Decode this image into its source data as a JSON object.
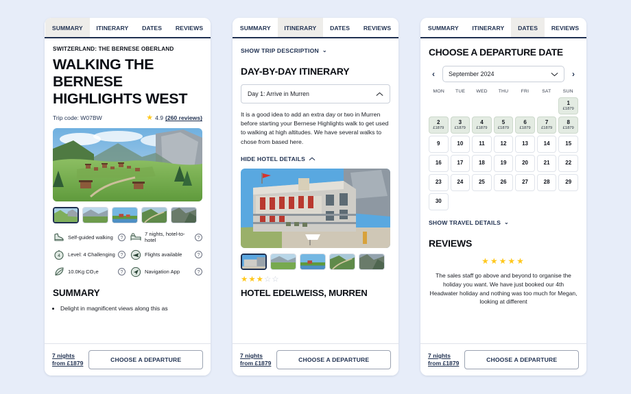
{
  "theme": {
    "background": "#e7edf9",
    "panel": "#ffffff",
    "ink": "#1f3050",
    "star": "#ffc81e",
    "available_day": "#e3ebe2",
    "active_tab": "#eeedea"
  },
  "tabs": [
    "SUMMARY",
    "ITINERARY",
    "DATES",
    "REVIEWS"
  ],
  "footer": {
    "nights_line1": "7 nights",
    "nights_line2": "from £1879",
    "cta": "CHOOSE A DEPARTURE"
  },
  "panel_summary": {
    "active_tab": "SUMMARY",
    "eyebrow": "SWITZERLAND: THE BERNESE OBERLAND",
    "title": "WALKING THE BERNESE HIGHLIGHTS WEST",
    "trip_code": "Trip code: W07BW",
    "rating_value": "4.9",
    "reviews_link": "(260 reviews)",
    "hero_alt": "alpine-village-hero-image",
    "thumbnails": [
      "alpine-village-thumb",
      "mountain-lake-thumb",
      "village-river-thumb",
      "mountain-trail-thumb",
      "valley-cliff-thumb"
    ],
    "features": [
      {
        "icon": "hiking-boot-icon",
        "label": "Self-guided walking"
      },
      {
        "icon": "hotel-bed-icon",
        "label": "7 nights, hotel-to-hotel"
      },
      {
        "icon": "difficulty-gauge-icon",
        "label": "Level: 4 Challenging"
      },
      {
        "icon": "airplane-icon",
        "label": "Flights available"
      },
      {
        "icon": "leaf-carbon-icon",
        "label": "10.0Kg CO₂e"
      },
      {
        "icon": "navigation-app-icon",
        "label": "Navigation App"
      }
    ],
    "help_icon": "question-mark-icon",
    "section_heading": "SUMMARY",
    "bullets": [
      "Delight in magnificent views along this as"
    ]
  },
  "panel_itinerary": {
    "active_tab": "ITINERARY",
    "show_trip_description": "SHOW TRIP DESCRIPTION",
    "heading": "DAY-BY-DAY ITINERARY",
    "accordion_label": "Day 1: Arrive in Murren",
    "accordion_state_icon": "chevron-up-icon",
    "paragraph": "It is a good idea to add an extra day or two in Murren before starting your Bernese Highlights walk to get used to walking at high altitudes. We have several walks to chose from based here.",
    "hide_hotel_details": "HIDE HOTEL DETAILS",
    "hotel_image_alt": "hotel-edelweiss-exterior",
    "hotel_thumbnails": [
      "hotel-exterior-thumb",
      "mountain-meadow-thumb",
      "village-river-thumb",
      "mountain-trail-thumb",
      "valley-cliff-thumb"
    ],
    "hotel_stars_filled": 3,
    "hotel_stars_total": 5,
    "hotel_name": "HOTEL EDELWEISS, MURREN"
  },
  "panel_dates": {
    "active_tab": "DATES",
    "heading": "CHOOSE A DEPARTURE DATE",
    "prev_icon": "chevron-left-icon",
    "next_icon": "chevron-right-icon",
    "month_value": "September 2024",
    "month_caret_icon": "chevron-down-icon",
    "day_names": [
      "MON",
      "TUE",
      "WED",
      "THU",
      "FRI",
      "SAT",
      "SUN"
    ],
    "leading_blanks": 6,
    "days": [
      {
        "n": "1",
        "price": "£1879",
        "available": true
      },
      {
        "n": "2",
        "price": "£1879",
        "available": true
      },
      {
        "n": "3",
        "price": "£1879",
        "available": true
      },
      {
        "n": "4",
        "price": "£1879",
        "available": true
      },
      {
        "n": "5",
        "price": "£1879",
        "available": true
      },
      {
        "n": "6",
        "price": "£1879",
        "available": true
      },
      {
        "n": "7",
        "price": "£1879",
        "available": true
      },
      {
        "n": "8",
        "price": "£1879",
        "available": true
      },
      {
        "n": "9",
        "price": "",
        "available": false
      },
      {
        "n": "10",
        "price": "",
        "available": false
      },
      {
        "n": "11",
        "price": "",
        "available": false
      },
      {
        "n": "12",
        "price": "",
        "available": false
      },
      {
        "n": "13",
        "price": "",
        "available": false
      },
      {
        "n": "14",
        "price": "",
        "available": false
      },
      {
        "n": "15",
        "price": "",
        "available": false
      },
      {
        "n": "16",
        "price": "",
        "available": false
      },
      {
        "n": "17",
        "price": "",
        "available": false
      },
      {
        "n": "18",
        "price": "",
        "available": false
      },
      {
        "n": "19",
        "price": "",
        "available": false
      },
      {
        "n": "20",
        "price": "",
        "available": false
      },
      {
        "n": "21",
        "price": "",
        "available": false
      },
      {
        "n": "22",
        "price": "",
        "available": false
      },
      {
        "n": "23",
        "price": "",
        "available": false
      },
      {
        "n": "24",
        "price": "",
        "available": false
      },
      {
        "n": "25",
        "price": "",
        "available": false
      },
      {
        "n": "26",
        "price": "",
        "available": false
      },
      {
        "n": "27",
        "price": "",
        "available": false
      },
      {
        "n": "28",
        "price": "",
        "available": false
      },
      {
        "n": "29",
        "price": "",
        "available": false
      },
      {
        "n": "30",
        "price": "",
        "available": false
      }
    ],
    "show_travel_details": "SHOW TRAVEL DETAILS",
    "reviews_heading": "REVIEWS",
    "review_stars": 5,
    "review_text": "The sales staff go above and beyond to organise the holiday you want. We have just booked our 4th Headwater holiday and nothing was too much for Megan, looking at different"
  }
}
